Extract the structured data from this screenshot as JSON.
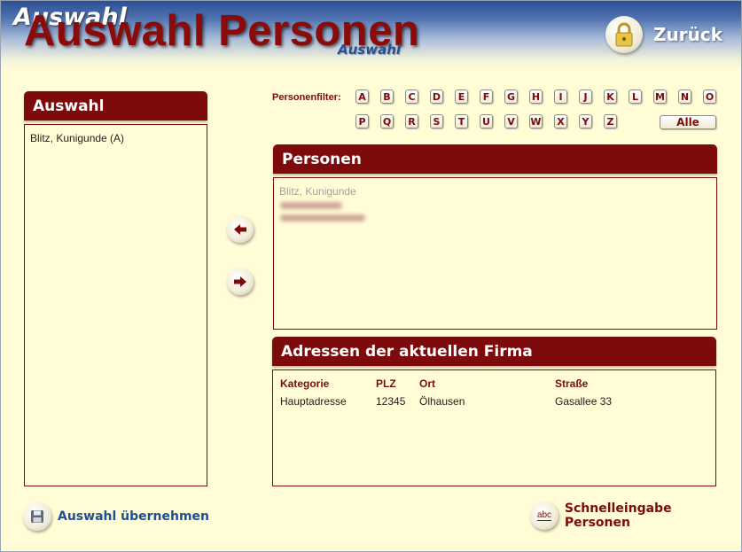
{
  "header": {
    "breadcrumb": "Auswahl",
    "title": "Auswahl Personen",
    "subtitle": "Auswahl",
    "back_label": "Zurück",
    "back_icon": "lock-icon"
  },
  "auswahl": {
    "title": "Auswahl",
    "items": [
      "Blitz, Kunigunde (A)"
    ]
  },
  "filter": {
    "label": "Personenfilter:",
    "letters": [
      "A",
      "B",
      "C",
      "D",
      "E",
      "F",
      "G",
      "H",
      "I",
      "J",
      "K",
      "L",
      "M",
      "N",
      "O",
      "P",
      "Q",
      "R",
      "S",
      "T",
      "U",
      "V",
      "W",
      "X",
      "Y",
      "Z"
    ],
    "all_label": "Alle"
  },
  "personen": {
    "title": "Personen",
    "items": [
      "Blitz, Kunigunde"
    ]
  },
  "adressen": {
    "title": "Adressen der aktuellen Firma",
    "columns": [
      "Kategorie",
      "PLZ",
      "Ort",
      "Straße"
    ],
    "rows": [
      [
        "Hauptadresse",
        "12345",
        "Ölhausen",
        "Gasallee 33"
      ]
    ]
  },
  "actions": {
    "save_label": "Auswahl übernehmen",
    "quick_label": "Schnelleingabe Personen",
    "quick_icon_text": "abc"
  },
  "colors": {
    "accent": "#7e0b0b",
    "background": "#fffcd6",
    "link_blue": "#1f4f8f"
  }
}
